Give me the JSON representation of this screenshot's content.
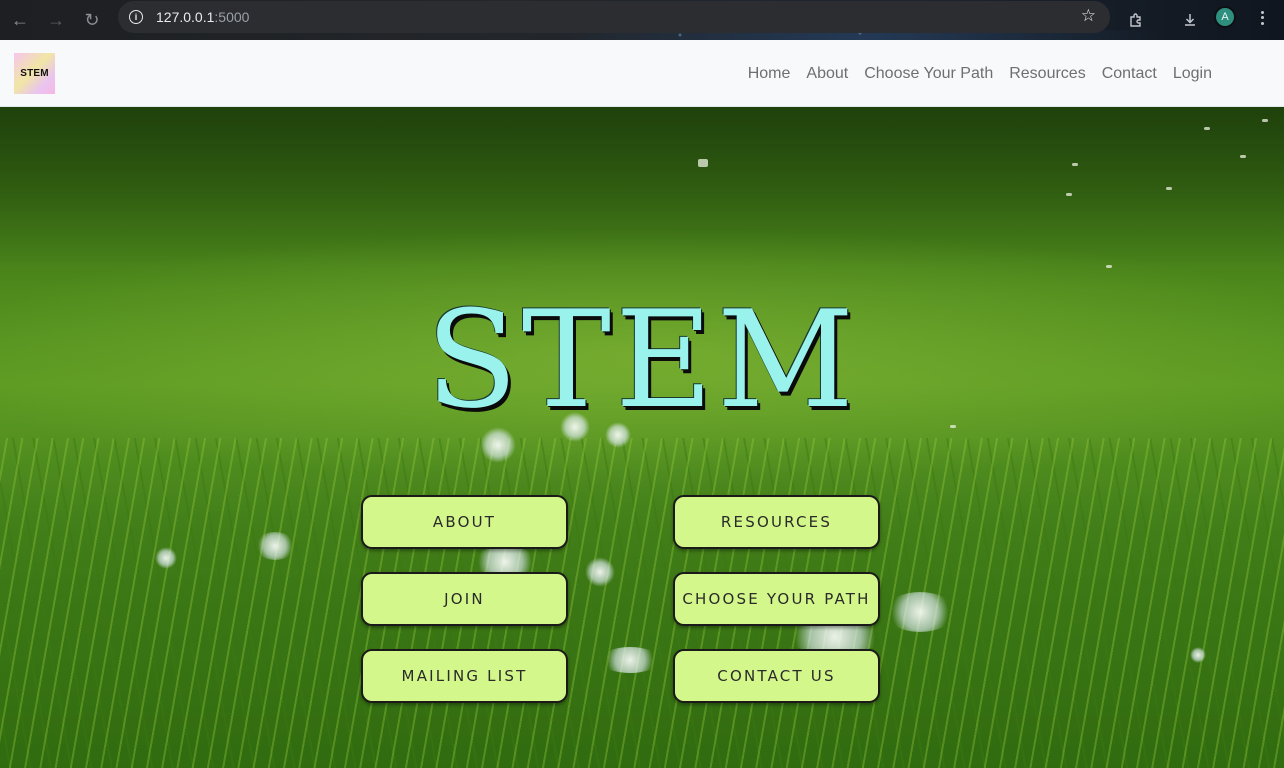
{
  "browser": {
    "back_icon": "←",
    "forward_icon": "→",
    "reload_icon": "↻",
    "url_host": "127.0.0.1",
    "url_port": ":5000",
    "avatar_letter": "A"
  },
  "site_nav": {
    "logo_text": "STEM",
    "links": [
      "Home",
      "About",
      "Choose Your Path",
      "Resources",
      "Contact",
      "Login"
    ]
  },
  "hero": {
    "title": "STEM",
    "buttons": {
      "about": "ABOUT",
      "resources": "RESOURCES",
      "join": "JOIN",
      "choose_path": "CHOOSE YOUR PATH",
      "mailing_list": "MAILING LIST",
      "contact_us": "CONTACT US"
    }
  },
  "colors": {
    "title": "#99f3ec",
    "button_bg": "#d4f78b",
    "nav_bg": "#f8f9fb"
  }
}
